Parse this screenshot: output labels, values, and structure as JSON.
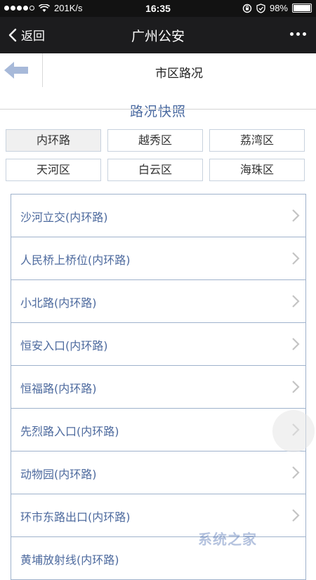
{
  "status_bar": {
    "carrier": "201K/s",
    "time": "16:35",
    "battery": "98%"
  },
  "nav": {
    "back_label": "返回",
    "title": "广州公安"
  },
  "subheader": {
    "title": "市区路况"
  },
  "section": {
    "title": "路况快照"
  },
  "districts": [
    {
      "label": "内环路",
      "active": true
    },
    {
      "label": "越秀区",
      "active": false
    },
    {
      "label": "荔湾区",
      "active": false
    },
    {
      "label": "天河区",
      "active": false
    },
    {
      "label": "白云区",
      "active": false
    },
    {
      "label": "海珠区",
      "active": false
    }
  ],
  "roads": [
    "沙河立交(内环路)",
    "人民桥上桥位(内环路)",
    "小北路(内环路)",
    "恒安入口(内环路)",
    "恒福路(内环路)",
    "先烈路入口(内环路)",
    "动物园(内环路)",
    "环市东路出口(内环路)",
    "黄埔放射线(内环路)"
  ],
  "watermark": "系统之家",
  "colors": {
    "accent_text": "#4d6a9e",
    "nav_bg": "#1c1c1e",
    "border": "#9fb2cc"
  }
}
